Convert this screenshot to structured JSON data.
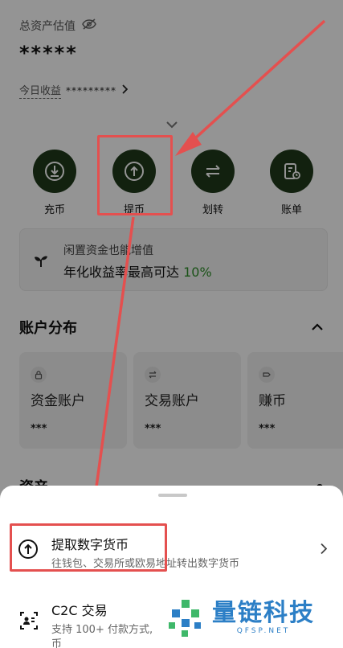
{
  "header": {
    "total_label": "总资产估值",
    "total_value": "*****",
    "today_label": "今日收益",
    "today_value": "*********"
  },
  "actions": [
    {
      "label": "充币",
      "icon": "deposit-icon"
    },
    {
      "label": "提币",
      "icon": "withdraw-icon"
    },
    {
      "label": "划转",
      "icon": "transfer-icon"
    },
    {
      "label": "账单",
      "icon": "bill-icon"
    }
  ],
  "promo": {
    "line1": "闲置资金也能增值",
    "line2_prefix": "年化收益率最高可达",
    "line2_pct": "10%"
  },
  "distribution": {
    "title": "账户分布",
    "cards": [
      {
        "name": "资金账户",
        "value": "***"
      },
      {
        "name": "交易账户",
        "value": "***"
      },
      {
        "name": "赚币",
        "value": "***"
      }
    ]
  },
  "assets": {
    "title": "资产"
  },
  "sheet": {
    "options": [
      {
        "title": "提取数字货币",
        "subtitle": "往钱包、交易所或欧易地址转出数字货币"
      },
      {
        "title": "C2C 交易",
        "subtitle": "支持 100+ 付款方式,",
        "subtitle2": "币"
      }
    ]
  },
  "watermark": {
    "brand": "量链科技",
    "domain": "QFSP.NET"
  },
  "colors": {
    "accent_green": "#1f3a1b",
    "highlight_red": "#e4504f",
    "promo_pct_green": "#2f8f2a",
    "watermark_blue": "#2c7fc6"
  }
}
